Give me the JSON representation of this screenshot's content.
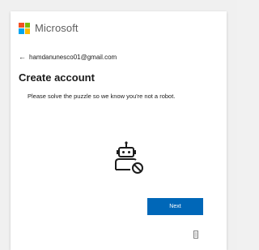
{
  "brand": {
    "name": "Microsoft",
    "logo_colors": [
      "#f25022",
      "#7fba00",
      "#00a4ef",
      "#ffb900"
    ]
  },
  "account": {
    "email": "hamdanunesco01@gmail.com",
    "back_icon": "arrow-left-icon"
  },
  "main": {
    "title": "Create account",
    "description": "Please solve the puzzle so we know you're not a robot.",
    "illustration": "robot-blocked-icon"
  },
  "actions": {
    "next_label": "Next",
    "accent": "#0067b8"
  },
  "footer": {
    "icon": "accessibility-document-icon"
  }
}
